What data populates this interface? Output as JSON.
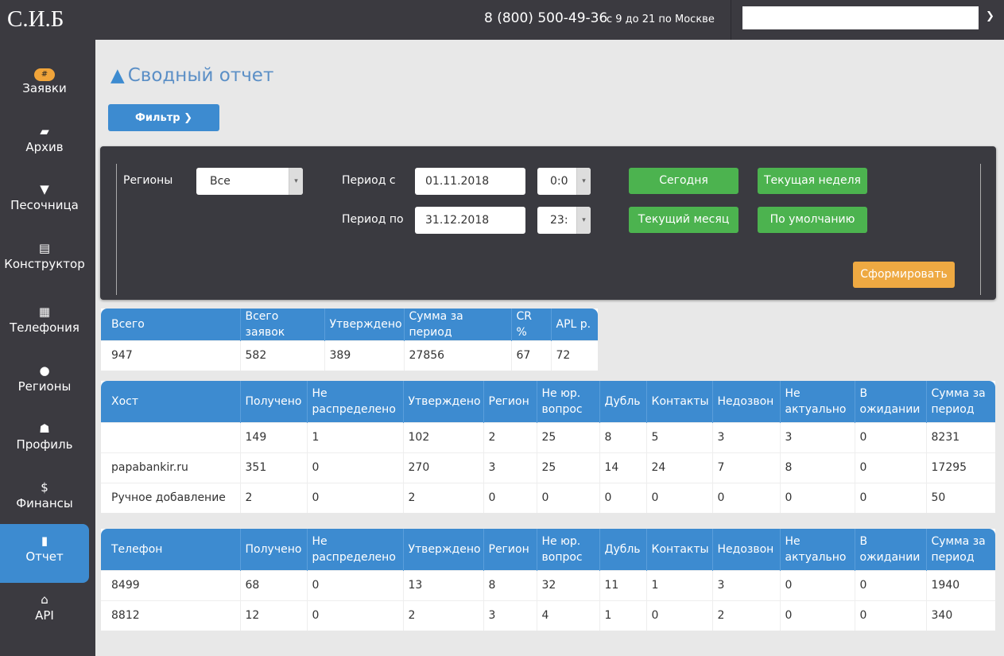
{
  "header": {
    "logo": "С.И.Б",
    "phone": "8 (800) 500-49-36",
    "hours": "с 9 до 21 по Москве",
    "search_value": ""
  },
  "sidebar": [
    {
      "icon": "#",
      "label": "Заявки"
    },
    {
      "icon": "▰",
      "label": "Архив"
    },
    {
      "icon": "▼",
      "label": "Песочница"
    },
    {
      "icon": "▤",
      "label": "Конструктор"
    },
    {
      "icon": "▦",
      "label": "Телефония"
    },
    {
      "icon": "●",
      "label": "Регионы"
    },
    {
      "icon": "☗",
      "label": "Профиль"
    },
    {
      "icon": "$",
      "label": "Финансы"
    },
    {
      "icon": "▮",
      "label": "Отчет"
    },
    {
      "icon": "⌂",
      "label": "API"
    }
  ],
  "page": {
    "title": "Сводный отчет",
    "filter_label": "Фильтр ❯"
  },
  "filter": {
    "regions_label": "Регионы",
    "regions_value": "Все",
    "from_label": "Период с",
    "from_date": "01.11.2018",
    "from_time": "0:0",
    "to_label": "Период по",
    "to_date": "31.12.2018",
    "to_time": "23:",
    "btn_today": "Сегодня",
    "btn_week": "Текущая неделя",
    "btn_month": "Текущий месяц",
    "btn_default": "По умолчанию",
    "btn_submit": "Сформировать"
  },
  "summary": {
    "headers": [
      "Всего",
      "Всего заявок",
      "Утверждено",
      "Сумма за период",
      "CR %",
      "APL р."
    ],
    "row": [
      "947",
      "582",
      "389",
      "27856",
      "67",
      "72"
    ]
  },
  "hosts": {
    "headers": [
      "Хост",
      "Получено",
      "Не распределено",
      "Утверждено",
      "Регион",
      "Не юр. вопрос",
      "Дубль",
      "Контакты",
      "Недозвон",
      "Не актуально",
      "В ожидании",
      "Сумма за период"
    ],
    "rows": [
      [
        "",
        "149",
        "1",
        "102",
        "2",
        "25",
        "8",
        "5",
        "3",
        "3",
        "0",
        "8231"
      ],
      [
        "papabankir.ru",
        "351",
        "0",
        "270",
        "3",
        "25",
        "14",
        "24",
        "7",
        "8",
        "0",
        "17295"
      ],
      [
        "Ручное добавление",
        "2",
        "0",
        "2",
        "0",
        "0",
        "0",
        "0",
        "0",
        "0",
        "0",
        "50"
      ]
    ]
  },
  "phones": {
    "headers": [
      "Телефон",
      "Получено",
      "Не распределено",
      "Утверждено",
      "Регион",
      "Не юр. вопрос",
      "Дубль",
      "Контакты",
      "Недозвон",
      "Не актуально",
      "В ожидании",
      "Сумма за период"
    ],
    "rows": [
      [
        "8499",
        "68",
        "0",
        "13",
        "8",
        "32",
        "11",
        "1",
        "3",
        "0",
        "0",
        "1940"
      ],
      [
        "8812",
        "12",
        "0",
        "2",
        "3",
        "4",
        "1",
        "0",
        "2",
        "0",
        "0",
        "340"
      ]
    ]
  }
}
